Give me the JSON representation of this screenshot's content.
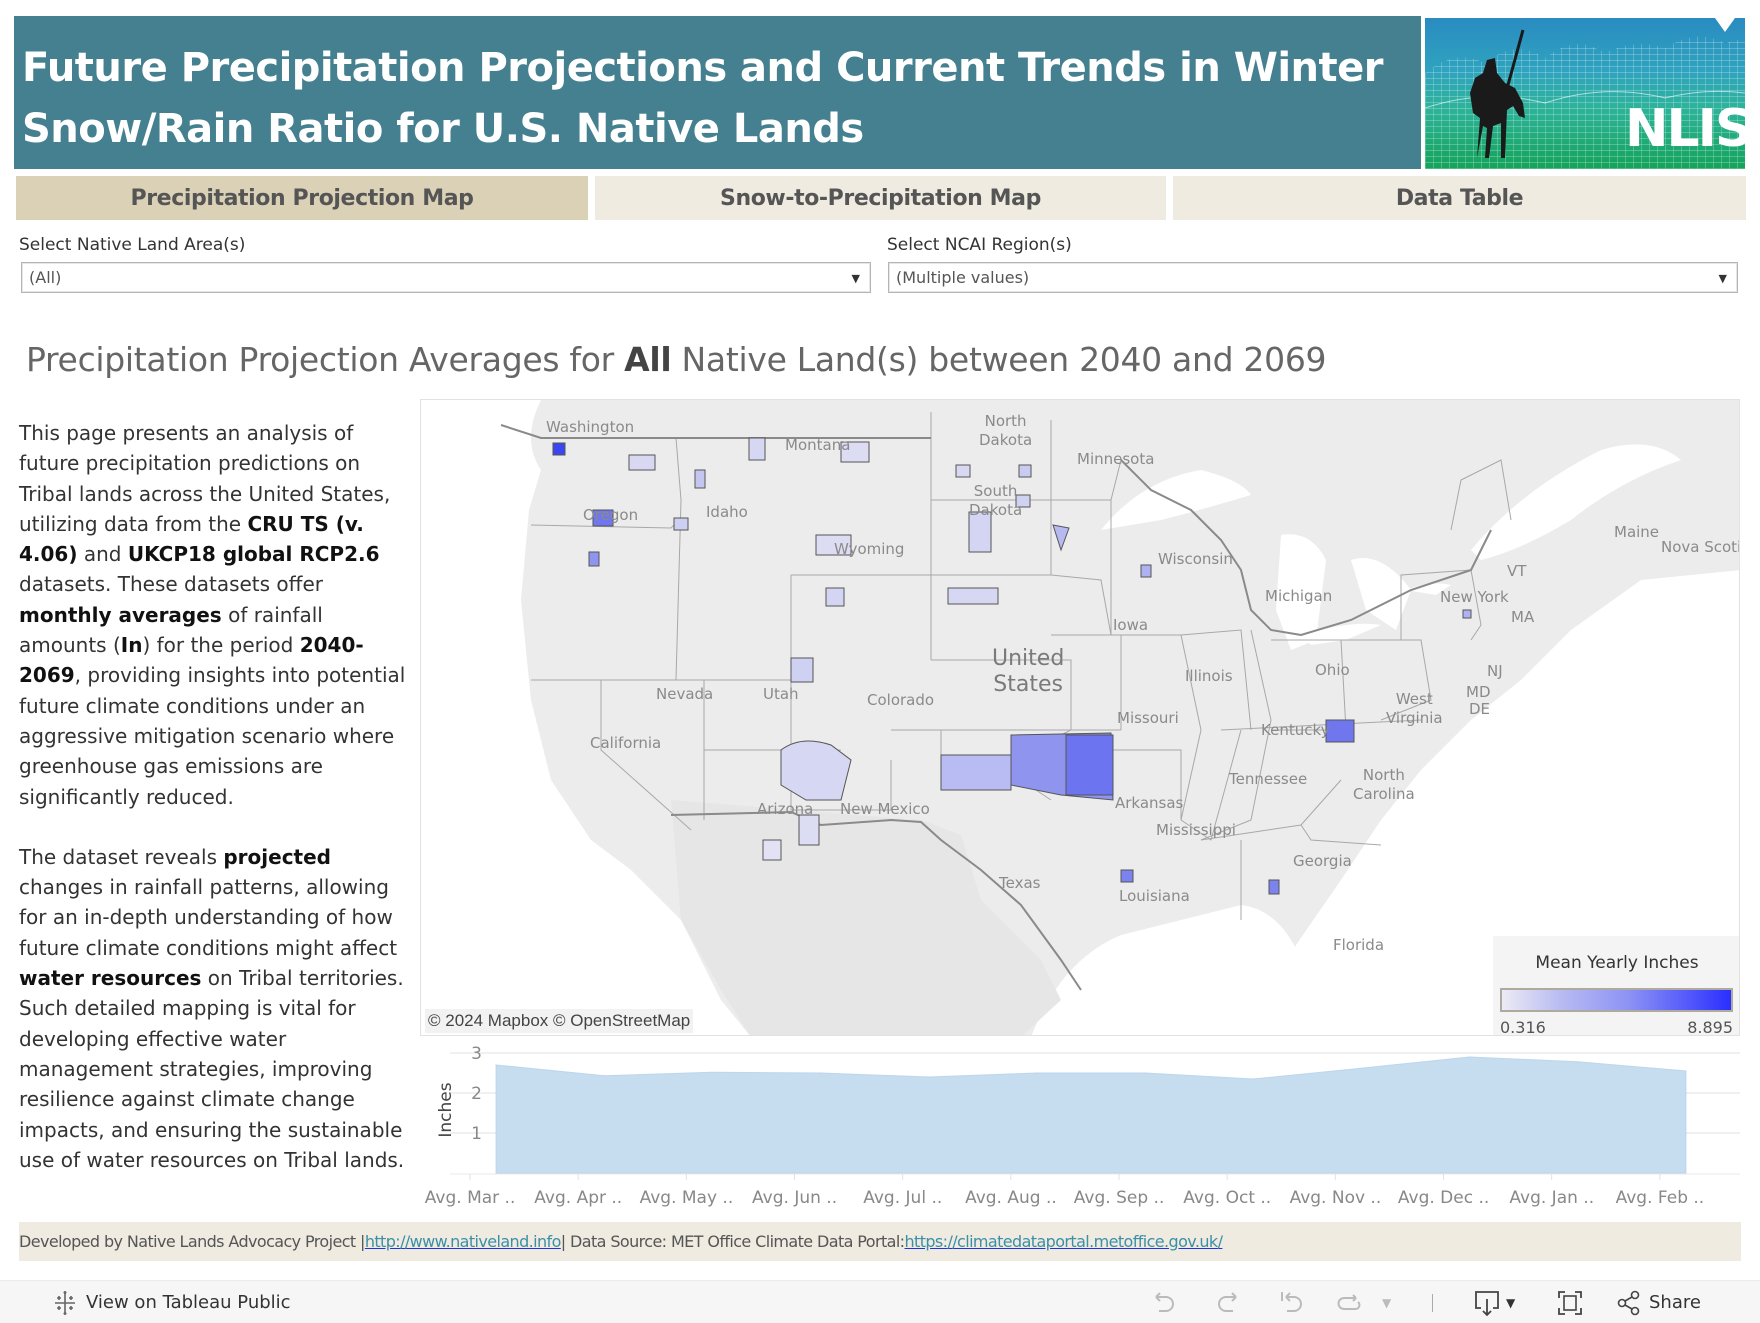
{
  "header": {
    "title": "Future Precipitation Projections and Current Trends in Winter Snow/Rain Ratio for U.S. Native Lands",
    "logo_text": "NLIS",
    "logo_icon": "rider-on-horse-logo"
  },
  "tabs": [
    {
      "label": "Precipitation Projection Map",
      "active": true
    },
    {
      "label": "Snow-to-Precipitation Map",
      "active": false
    },
    {
      "label": "Data Table",
      "active": false
    }
  ],
  "filters": {
    "native_land": {
      "label": "Select Native Land Area(s)",
      "value": "(All)"
    },
    "ncai_region": {
      "label": "Select NCAI Region(s)",
      "value": "(Multiple values)"
    }
  },
  "subtitle": {
    "prefix": "Precipitation Projection Averages for ",
    "bold": "All",
    "suffix": " Native Land(s) between 2040 and 2069"
  },
  "description": {
    "p1": [
      {
        "t": "This page presents an analysis of future precipitation predictions on Tribal lands across the United States, utilizing data from the ",
        "b": false
      },
      {
        "t": "CRU TS (v. 4.06)",
        "b": true
      },
      {
        "t": " and ",
        "b": false
      },
      {
        "t": "UKCP18 global RCP2.6",
        "b": true
      },
      {
        "t": " datasets. These datasets offer ",
        "b": false
      },
      {
        "t": "monthly averages",
        "b": true
      },
      {
        "t": " of rainfall amounts (",
        "b": false
      },
      {
        "t": "In",
        "b": true
      },
      {
        "t": ") for the period ",
        "b": false
      },
      {
        "t": "2040-2069",
        "b": true
      },
      {
        "t": ", providing insights into potential future climate conditions under an aggressive mitigation scenario where greenhouse gas emissions are significantly reduced.",
        "b": false
      }
    ],
    "p2": [
      {
        "t": "The dataset reveals ",
        "b": false
      },
      {
        "t": "projected",
        "b": true
      },
      {
        "t": " changes in rainfall patterns, allowing for an in-depth understanding of how future climate conditions might affect ",
        "b": false
      },
      {
        "t": "water resources",
        "b": true
      },
      {
        "t": " on Tribal territories. Such detailed mapping is vital for developing effective water management strategies, improving resilience against climate change impacts, and ensuring the sustainable use of water resources on Tribal lands.",
        "b": false
      }
    ]
  },
  "map": {
    "labels": {
      "washington": "Washington",
      "oregon": "Oregon",
      "idaho": "Idaho",
      "montana": "Montana",
      "north_dakota": "North\nDakota",
      "south_dakota": "South\nDakota",
      "wyoming": "Wyoming",
      "minnesota": "Minnesota",
      "wisconsin": "Wisconsin",
      "michigan": "Michigan",
      "iowa": "Iowa",
      "illinois": "Illinois",
      "ohio": "Ohio",
      "new_york": "New York",
      "vt": "VT",
      "ma": "MA",
      "maine": "Maine",
      "nova_scotia": "Nova Scoti",
      "nj": "NJ",
      "md": "MD",
      "de": "DE",
      "west_virginia": "West\nVirginia",
      "kentucky": "Kentucky",
      "missouri": "Missouri",
      "nevada": "Nevada",
      "utah": "Utah",
      "colorado": "Colorado",
      "california": "California",
      "arizona": "Arizona",
      "new_mexico": "New Mexico",
      "texas": "Texas",
      "arkansas": "Arkansas",
      "tennessee": "Tennessee",
      "north_carolina": "North\nCarolina",
      "mississippi": "Mississippi",
      "georgia": "Georgia",
      "louisiana": "Louisiana",
      "florida": "Florida",
      "united_states": "United\nStates"
    },
    "attribution": "© 2024 Mapbox  © OpenStreetMap",
    "legend": {
      "title": "Mean Yearly Inches",
      "min": "0.316",
      "max": "8.895",
      "color_low": "#ecebf4",
      "color_high": "#2b2fff"
    }
  },
  "chart_data": {
    "type": "area",
    "title": "",
    "xlabel": "",
    "ylabel": "Inches",
    "categories": [
      "Avg. Mar ..",
      "Avg. Apr ..",
      "Avg. May ..",
      "Avg. Jun ..",
      "Avg. Jul ..",
      "Avg. Aug ..",
      "Avg. Sep ..",
      "Avg. Oct ..",
      "Avg. Nov ..",
      "Avg. Dec ..",
      "Avg. Jan ..",
      "Avg. Feb .."
    ],
    "values": [
      2.7,
      2.43,
      2.52,
      2.5,
      2.4,
      2.5,
      2.5,
      2.35,
      2.62,
      2.9,
      2.78,
      2.55
    ],
    "yticks": [
      1,
      2,
      3
    ],
    "ylim": [
      0,
      3
    ],
    "grid": true,
    "color": "#c6dcef"
  },
  "footer": {
    "prefix": "Developed by Native Lands Advocacy Project | ",
    "link1": "http://www.nativeland.info",
    "middle": " | Data Source: MET Office Climate Data Portal: ",
    "link2": "https://climatedataportal.metoffice.gov.uk/"
  },
  "toolbar": {
    "view_on_tableau": "View on Tableau Public",
    "share": "Share",
    "icons": [
      "undo-icon",
      "redo-icon",
      "revert-icon",
      "refresh-icon",
      "download-icon",
      "fullscreen-icon",
      "share-icon"
    ]
  }
}
